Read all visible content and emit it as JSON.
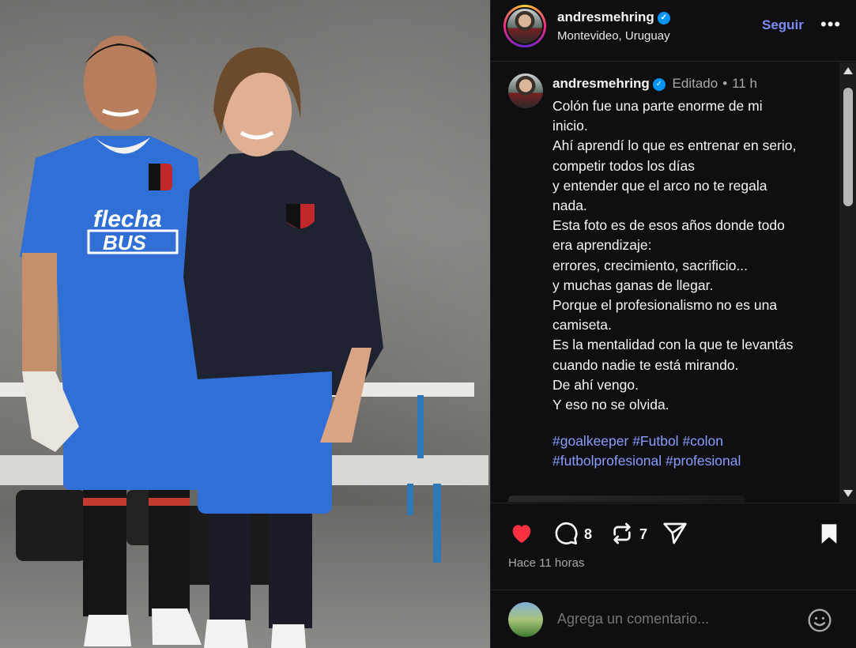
{
  "post": {
    "username": "andresmehring",
    "location": "Montevideo, Uruguay",
    "follow_label": "Seguir",
    "more_label": "•••"
  },
  "caption": {
    "username": "andresmehring",
    "edited_label": "Editado",
    "age": "11 h",
    "lines": [
      "Colón fue una parte enorme de mi",
      "inicio.",
      "Ahí aprendí lo que es entrenar en serio,",
      "competir todos los días",
      "y entender que el arco no te regala",
      "nada.",
      "Esta foto es de esos años donde todo",
      "era aprendizaje:",
      "errores, crecimiento, sacrificio...",
      "y muchas ganas de llegar.",
      "Porque el profesionalismo no es una",
      "camiseta.",
      "Es la mentalidad con la que te levantás",
      "cuando nadie te está mirando.",
      "De ahí vengo.",
      "Y eso no se olvida."
    ],
    "hashtags": [
      "#goalkeeper",
      "#Futbol",
      "#colon",
      "#futbolprofesional",
      "#profesional"
    ]
  },
  "actions": {
    "comments_count": "8",
    "reposts_count": "7",
    "posted_ago": "Hace 11 horas"
  },
  "comment_box": {
    "placeholder": "Agrega un comentario..."
  },
  "photo": {
    "left_shirt_sponsor_line1": "flecha",
    "left_shirt_sponsor_line2": "BUS"
  },
  "colors": {
    "accent_link": "#8a9dff",
    "follow": "#7d8cf5",
    "like_heart": "#ff3040",
    "verified": "#0095f6",
    "panel_bg": "#0f0f12"
  }
}
